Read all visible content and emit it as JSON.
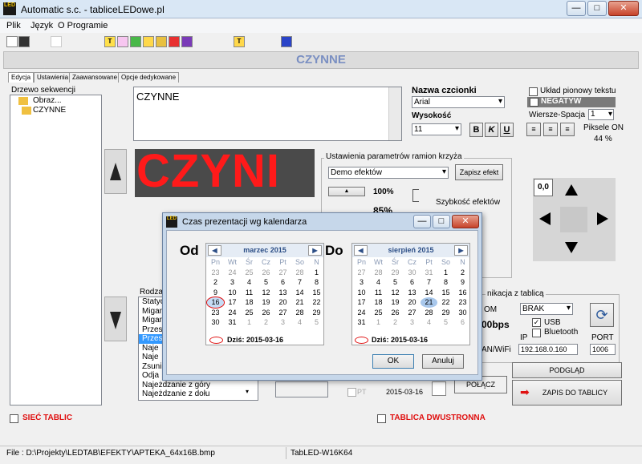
{
  "app": {
    "title": "Automatic s.c. - tabliceLEDowe.pl",
    "icon_text": "LED",
    "min": "—",
    "max": "□",
    "close": "✕"
  },
  "menu": [
    "Plik",
    "Język",
    "O Programie"
  ],
  "banner": "CZYNNE",
  "tabs": [
    "Edycja",
    "Ustawienia",
    "Zaawansowane",
    "Opcje dedykowane"
  ],
  "tree": {
    "title": "Drzewo sekwencji",
    "root": "Obraz...",
    "child": "CZYNNE"
  },
  "editor_text": "CZYNNE",
  "font": {
    "label": "Nazwa czcionki",
    "value": "Arial",
    "height_label": "Wysokość",
    "height_value": "11",
    "bold": "B",
    "italic": "K",
    "underline": "U"
  },
  "options": {
    "vertical": "Układ pionowy tekstu",
    "negative": "NEGATYW",
    "rows_label": "Wiersze-Spacja",
    "rows_value": "1",
    "pixels_on": "Piksele ON",
    "pixels_pct": "44 %"
  },
  "preview_text": "CZYNI",
  "params": {
    "title": "Ustawienia parametrów ramion krzyża",
    "effect": "Demo efektów",
    "save": "Zapisz efekt",
    "pct100": "100%",
    "pct85": "85%",
    "speed": "Szybkość efektów",
    "s": "ś"
  },
  "zero_btn": "0,0",
  "effects_title": "Rodza",
  "effects": [
    "Statyc",
    "Migan",
    "Migan",
    "Przes",
    "Przes",
    "Naje",
    "Naje",
    "Zsuni",
    "Odja",
    "Najeżdzanie z góry",
    "Najeżdzanie z dołu"
  ],
  "connection": {
    "title": "nikacja z tablicą",
    "com": "OM",
    "com_value": "BRAK",
    "speed": "00bps",
    "usb": "USB",
    "bluetooth": "Bluetooth",
    "lan": "AN/WiFi",
    "ip_label": "IP",
    "ip": "192.168.0.160",
    "port_label": "PORT",
    "port": "1006"
  },
  "bottom": {
    "preview": "PODGLĄD",
    "write": "ZAPIS  DO TABLICY",
    "connect": "POŁĄCZ",
    "date": "2015-03-16",
    "pt": "PT",
    "siec": "SIEĆ TABLIC",
    "dual": "TABLICA DWUSTRONNA"
  },
  "dialog": {
    "title": "Czas prezentacji wg kalendarza",
    "from": "Od",
    "to": "Do",
    "ok": "OK",
    "cancel": "Anuluj",
    "dows": [
      "Pn",
      "Wt",
      "Śr",
      "Cz",
      "Pt",
      "So",
      "N"
    ],
    "cal1": {
      "month": "marzec 2015",
      "today": "Dziś: 2015-03-16",
      "days": [
        "23",
        "24",
        "25",
        "26",
        "27",
        "28",
        "1",
        "2",
        "3",
        "4",
        "5",
        "6",
        "7",
        "8",
        "9",
        "10",
        "11",
        "12",
        "13",
        "14",
        "15",
        "16",
        "17",
        "18",
        "19",
        "20",
        "21",
        "22",
        "23",
        "24",
        "25",
        "26",
        "27",
        "28",
        "29",
        "30",
        "31",
        "1",
        "2",
        "3",
        "4",
        "5"
      ]
    },
    "cal2": {
      "month": "sierpień 2015",
      "today": "Dziś: 2015-03-16",
      "days": [
        "27",
        "28",
        "29",
        "30",
        "31",
        "1",
        "2",
        "3",
        "4",
        "5",
        "6",
        "7",
        "8",
        "9",
        "10",
        "11",
        "12",
        "13",
        "14",
        "15",
        "16",
        "17",
        "18",
        "19",
        "20",
        "21",
        "22",
        "23",
        "24",
        "25",
        "26",
        "27",
        "28",
        "29",
        "30",
        "31",
        "1",
        "2",
        "3",
        "4",
        "5",
        "6"
      ]
    }
  },
  "status": {
    "file": "File : D:\\Projekty\\LEDTAB\\EFEKTY\\APTEKA_64x16B.bmp",
    "model": "TabLED-W16K64"
  },
  "colors": {
    "red": "#ff1a1a",
    "selected": "#3399ff",
    "led_bg": "#4a4a4a"
  }
}
